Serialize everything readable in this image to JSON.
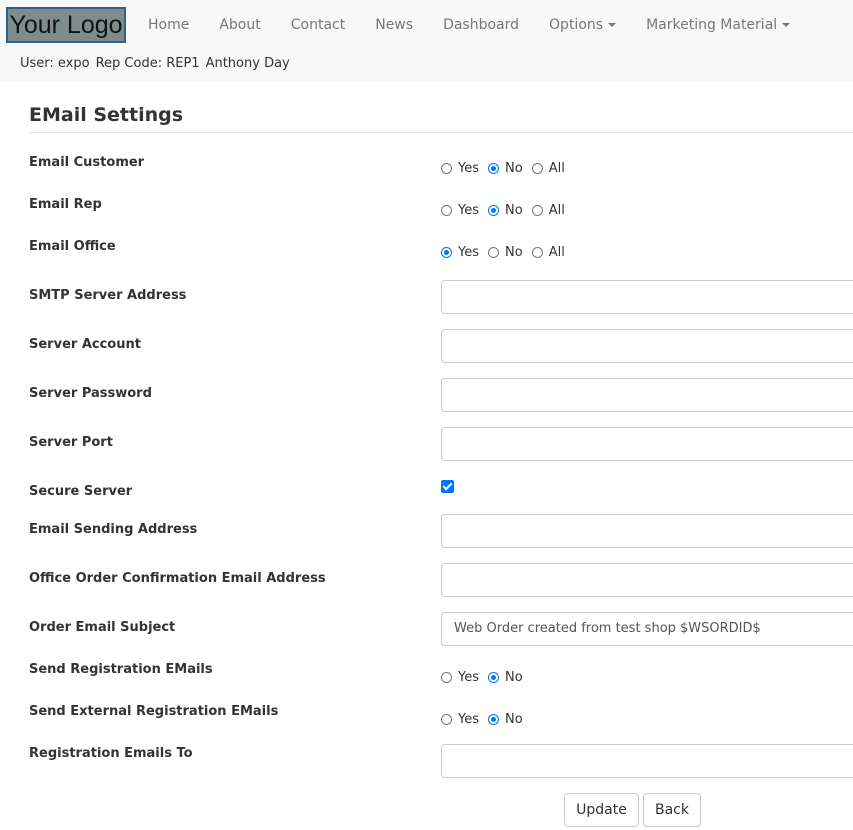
{
  "nav": {
    "logo_text": "Your Logo",
    "items": [
      "Home",
      "About",
      "Contact",
      "News",
      "Dashboard",
      "Options",
      "Marketing Material"
    ],
    "user_label": "User: expo",
    "rep_label": "Rep Code: REP1",
    "user_name": "Anthony Day"
  },
  "page": {
    "title": "EMail Settings",
    "fields": {
      "email_customer": "Email Customer",
      "email_rep": "Email Rep",
      "email_office": "Email Office",
      "smtp_server": "SMTP Server Address",
      "server_account": "Server Account",
      "server_password": "Server Password",
      "server_port": "Server Port",
      "secure_server": "Secure Server",
      "sending_address": "Email Sending Address",
      "office_confirm": "Office Order Confirmation Email Address",
      "order_subject": "Order Email Subject",
      "send_reg": "Send Registration EMails",
      "send_ext_reg": "Send External Registration EMails",
      "reg_to": "Registration Emails To"
    },
    "options": {
      "yes": "Yes",
      "no": "No",
      "all": "All"
    },
    "values": {
      "order_subject": "Web Order created from test shop $WSORDID$"
    },
    "buttons": {
      "update": "Update",
      "back": "Back"
    }
  }
}
